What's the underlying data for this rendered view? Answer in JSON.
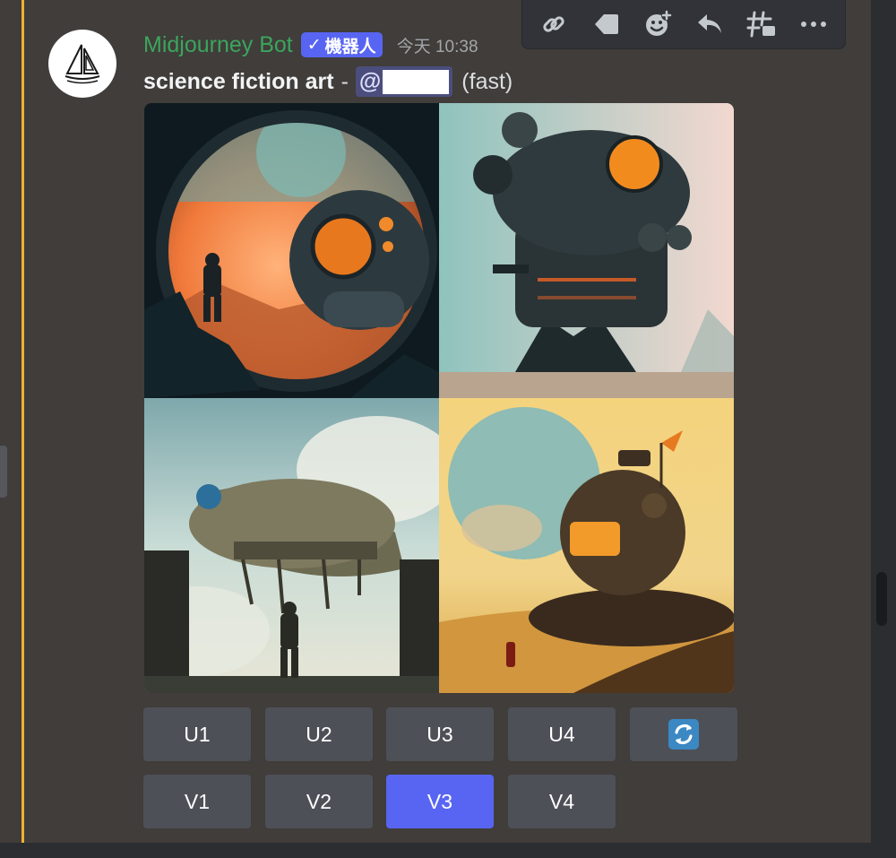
{
  "message": {
    "author": "Midjourney Bot",
    "bot_tag": "機器人",
    "verified_check": "✓",
    "timestamp": "今天 10:38",
    "prompt_text": "science fiction art",
    "prompt_separator": "-",
    "mention_prefix": "@",
    "speed_label": "(fast)"
  },
  "toolbar": {
    "icons": [
      "link-icon",
      "tag-icon",
      "add-reaction-icon",
      "reply-icon",
      "create-thread-icon",
      "more-icon"
    ]
  },
  "image_grid": {
    "panels": [
      "astronaut-porthole-sphere",
      "tower-spaceship",
      "flying-airship",
      "dome-house-desert"
    ]
  },
  "buttons": {
    "upscale": [
      "U1",
      "U2",
      "U3",
      "U4"
    ],
    "variation": [
      "V1",
      "V2",
      "V3",
      "V4"
    ],
    "reroll_icon": "refresh-icon",
    "active": "V3"
  },
  "colors": {
    "accent": "#5865f2",
    "username": "#3ba55d",
    "highlight": "#f0b232"
  }
}
